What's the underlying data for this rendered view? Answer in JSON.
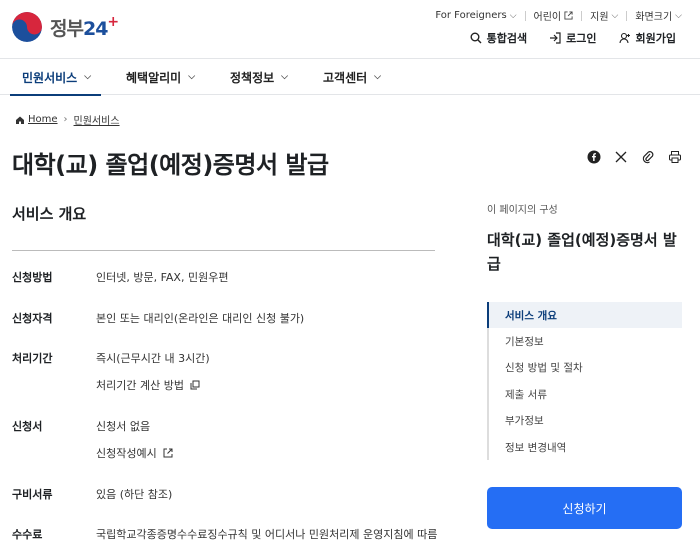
{
  "header": {
    "logo_text": "정부",
    "logo_num": "24",
    "logo_plus": "+",
    "util": {
      "foreigners": "For Foreigners",
      "kids": "어린이",
      "support": "지원",
      "font_size": "화면크기"
    },
    "actions": {
      "search": "통합검색",
      "login": "로그인",
      "signup": "회원가입"
    }
  },
  "gnb": {
    "items": [
      "민원서비스",
      "혜택알리미",
      "정책정보",
      "고객센터"
    ]
  },
  "breadcrumb": {
    "home": "Home",
    "current": "민원서비스"
  },
  "page": {
    "title": "대학(교) 졸업(예정)증명서 발급",
    "section_title": "서비스 개요"
  },
  "overview": {
    "method": {
      "label": "신청방법",
      "value": "인터넷, 방문, FAX, 민원우편"
    },
    "eligibility": {
      "label": "신청자격",
      "value": "본인 또는 대리인(온라인은 대리인 신청 불가)"
    },
    "period": {
      "label": "처리기간",
      "value": "즉시(근무시간 내 3시간)",
      "link": "처리기간 계산 방법"
    },
    "form": {
      "label": "신청서",
      "value": "신청서 없음",
      "link": "신청작성예시"
    },
    "docs": {
      "label": "구비서류",
      "value": "있음 (하단 참조)"
    },
    "fee": {
      "label": "수수료",
      "value": "국립학교각종증명수수료징수규칙 및 어디서나 민원처리제 운영지침에 따름"
    }
  },
  "toc": {
    "caption": "이 페이지의 구성",
    "title": "대학(교) 졸업(예정)증명서 발급",
    "items": [
      "서비스 개요",
      "기본정보",
      "신청 방법 및 절차",
      "제출 서류",
      "부가정보",
      "정보 변경내역"
    ]
  },
  "apply_button": "신청하기",
  "colors": {
    "primary_button": "#256ef4",
    "nav_active": "#0b3d7a"
  }
}
